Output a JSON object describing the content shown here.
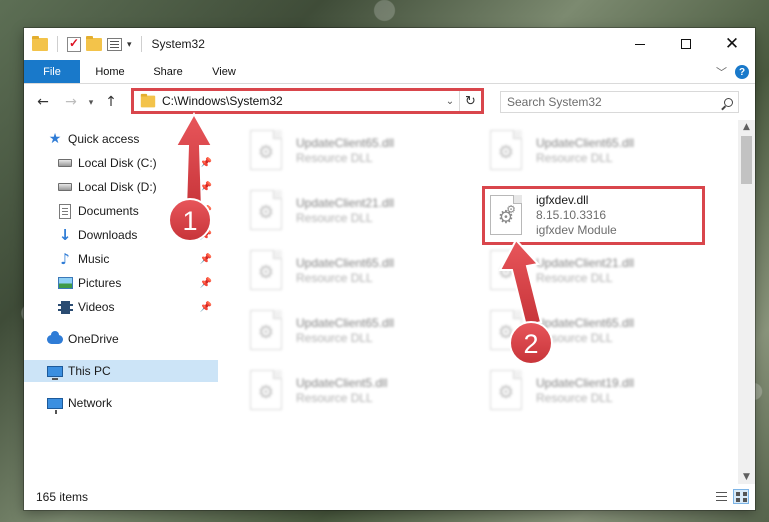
{
  "window": {
    "title": "System32",
    "controls": {
      "minimize": "minimize",
      "maximize": "maximize",
      "close": "close"
    }
  },
  "ribbon": {
    "tabs": [
      {
        "label": "File",
        "active": true
      },
      {
        "label": "Home"
      },
      {
        "label": "Share"
      },
      {
        "label": "View"
      }
    ],
    "help_label": "?"
  },
  "navigation": {
    "address": "C:\\Windows\\System32",
    "search_placeholder": "Search System32"
  },
  "sidebar": {
    "items": [
      {
        "label": "Quick access",
        "icon": "star-icon",
        "pinned": false
      },
      {
        "label": "Local Disk (C:)",
        "icon": "drive-icon",
        "pinned": true
      },
      {
        "label": "Local Disk (D:)",
        "icon": "drive-icon",
        "pinned": true
      },
      {
        "label": "Documents",
        "icon": "documents-icon",
        "pinned": true
      },
      {
        "label": "Downloads",
        "icon": "downloads-icon",
        "pinned": true
      },
      {
        "label": "Music",
        "icon": "music-icon",
        "pinned": true
      },
      {
        "label": "Pictures",
        "icon": "pictures-icon",
        "pinned": true
      },
      {
        "label": "Videos",
        "icon": "videos-icon",
        "pinned": true
      },
      {
        "label": "OneDrive",
        "icon": "onedrive-icon",
        "pinned": false
      },
      {
        "label": "This PC",
        "icon": "this-pc-icon",
        "pinned": false,
        "selected": true
      },
      {
        "label": "Network",
        "icon": "network-icon",
        "pinned": false
      }
    ]
  },
  "files": [
    {
      "name": "UpdateClient65.dll",
      "type": "Resource DLL",
      "blurred": true
    },
    {
      "name": "UpdateClient65.dll",
      "type": "Resource DLL",
      "blurred": true
    },
    {
      "name": "UpdateClient21.dll",
      "type": "Resource DLL",
      "blurred": true
    },
    {
      "name": "igfxdev.dll",
      "version": "8.15.10.3316",
      "type": "igfxdev Module",
      "blurred": false,
      "highlighted": true
    },
    {
      "name": "UpdateClient65.dll",
      "type": "Resource DLL",
      "blurred": true
    },
    {
      "name": "UpdateClient21.dll",
      "type": "Resource DLL",
      "blurred": true
    },
    {
      "name": "UpdateClient65.dll",
      "type": "Resource DLL",
      "blurred": true
    },
    {
      "name": "UpdateClient65.dll",
      "type": "Resource DLL",
      "blurred": true
    },
    {
      "name": "UpdateClient5.dll",
      "type": "Resource DLL",
      "blurred": true
    },
    {
      "name": "UpdateClient19.dll",
      "type": "Resource DLL",
      "blurred": true
    }
  ],
  "status": {
    "item_count": "165 items"
  },
  "annotations": [
    {
      "number": "1"
    },
    {
      "number": "2"
    }
  ],
  "colors": {
    "accent": "#1979ca",
    "highlight_red": "#d9464c",
    "selected_bg": "#cce4f7"
  }
}
